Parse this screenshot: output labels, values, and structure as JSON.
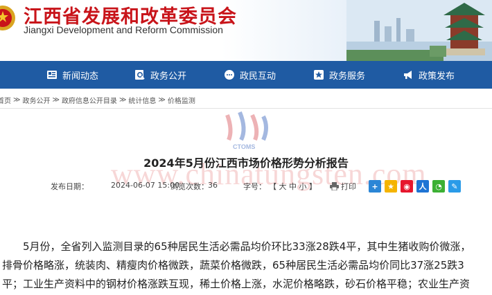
{
  "header": {
    "title": "江西省发展和改革委员会",
    "subtitle": "Jiangxi Development and Reform Commission"
  },
  "nav": [
    {
      "label": "新闻动态",
      "icon": "newspaper-icon"
    },
    {
      "label": "政务公开",
      "icon": "search-document-icon"
    },
    {
      "label": "政民互动",
      "icon": "chat-icon"
    },
    {
      "label": "政务服务",
      "icon": "star-badge-icon"
    },
    {
      "label": "政策发布",
      "icon": "megaphone-icon"
    }
  ],
  "breadcrumb": [
    "首页",
    "≫",
    "政务公开",
    "≫",
    "政府信息公开目录",
    "≫",
    "统计信息",
    "≫",
    "价格监测"
  ],
  "watermark": {
    "logo_text": "CTOMS",
    "url_text": "www.chinatungsten.com"
  },
  "article": {
    "title": "2024年5月份江西市场价格形势分析报告",
    "meta": {
      "date_label": "发布日期：",
      "date_value": "2024-06-07 15:00",
      "views_label": "浏览次数：",
      "views_value": "36",
      "font_label": "字号：",
      "font_options": "【 大 中 小 】",
      "print_label": "打印"
    },
    "share_icons": [
      "plus-share-icon",
      "qzone-star-icon",
      "weibo-icon",
      "renren-icon",
      "wechat-icon",
      "edit-share-icon"
    ],
    "paragraph_lines": [
      "5月份，全省列入监测目录的65种居民生活必需品均价环比33涨28跌4平，其中生猪收购价微涨，",
      "排骨价格略涨，统装肉、精瘦肉价格微跌，蔬菜价格微跌，65种居民生活必需品均价同比37涨25跌3",
      "平；工业生产资料中的钢材价格涨跌互现，稀土价格上涨，水泥价格略跌，砂石价格平稳；农业生产资"
    ]
  },
  "colors": {
    "brand_red": "#c8141a",
    "nav_blue": "#1f5ba3"
  }
}
